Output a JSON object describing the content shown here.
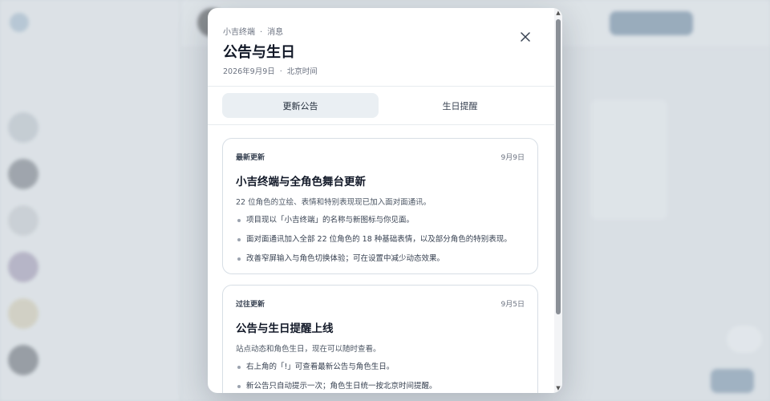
{
  "modal": {
    "eyebrow_app": "小吉终端",
    "eyebrow_sep": "·",
    "eyebrow_section": "消息",
    "title": "公告与生日",
    "date": "2026年9月9日",
    "date_sep": "·",
    "timezone": "北京时间",
    "close_icon": "close-icon"
  },
  "tabs": [
    {
      "label": "更新公告",
      "active": true
    },
    {
      "label": "生日提醒",
      "active": false
    }
  ],
  "announcements": [
    {
      "tag": "最新更新",
      "date": "9月9日",
      "title": "小吉终端与全角色舞台更新",
      "description": "22 位角色的立绘、表情和特别表现现已加入面对面通讯。",
      "items": [
        "项目现以「小吉终端」的名称与新图标与你见面。",
        "面对面通讯加入全部 22 位角色的 18 种基础表情，以及部分角色的特别表现。",
        "改善窄屏输入与角色切换体验；可在设置中减少动态效果。"
      ]
    },
    {
      "tag": "过往更新",
      "date": "9月5日",
      "title": "公告与生日提醒上线",
      "description": "站点动态和角色生日，现在可以随时查看。",
      "items": [
        "右上角的「!」可查看最新公告与角色生日。",
        "新公告只自动提示一次；角色生日统一按北京时间提醒。"
      ]
    }
  ],
  "colors": {
    "active_tab_bg": "#eaeff3",
    "card_border": "#d7dee5",
    "scrim": "#cdd4dc"
  }
}
